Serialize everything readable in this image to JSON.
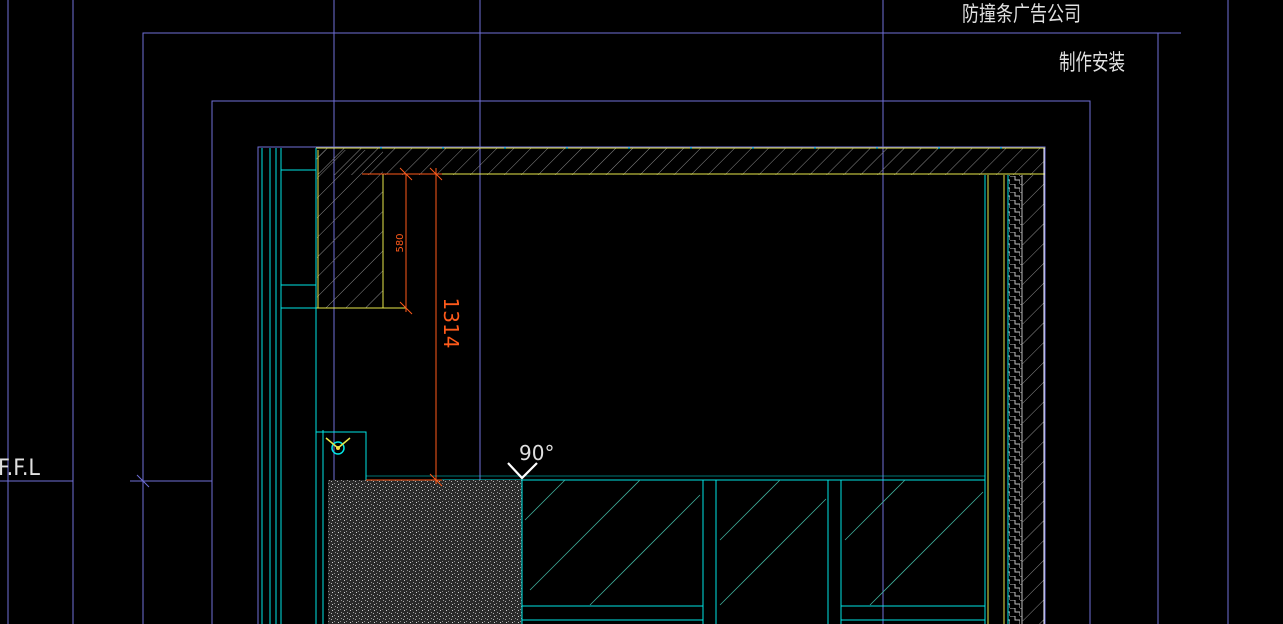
{
  "drawing": {
    "annotations": {
      "company": "防撞条广告公司",
      "install_note": "制作安装"
    },
    "level_label": "F.F.L",
    "dimensions": {
      "small": "580",
      "large": "1314"
    },
    "angle_label": "90°"
  },
  "colors": {
    "background": "#000000",
    "frame_line": "#6f6fd8",
    "cyan": "#00e5e5",
    "yellow": "#e8e84a",
    "dimension": "#ff5a1a",
    "hatch": "#9a9a9a",
    "white": "#ffffff",
    "text": "#e0e0e0"
  }
}
